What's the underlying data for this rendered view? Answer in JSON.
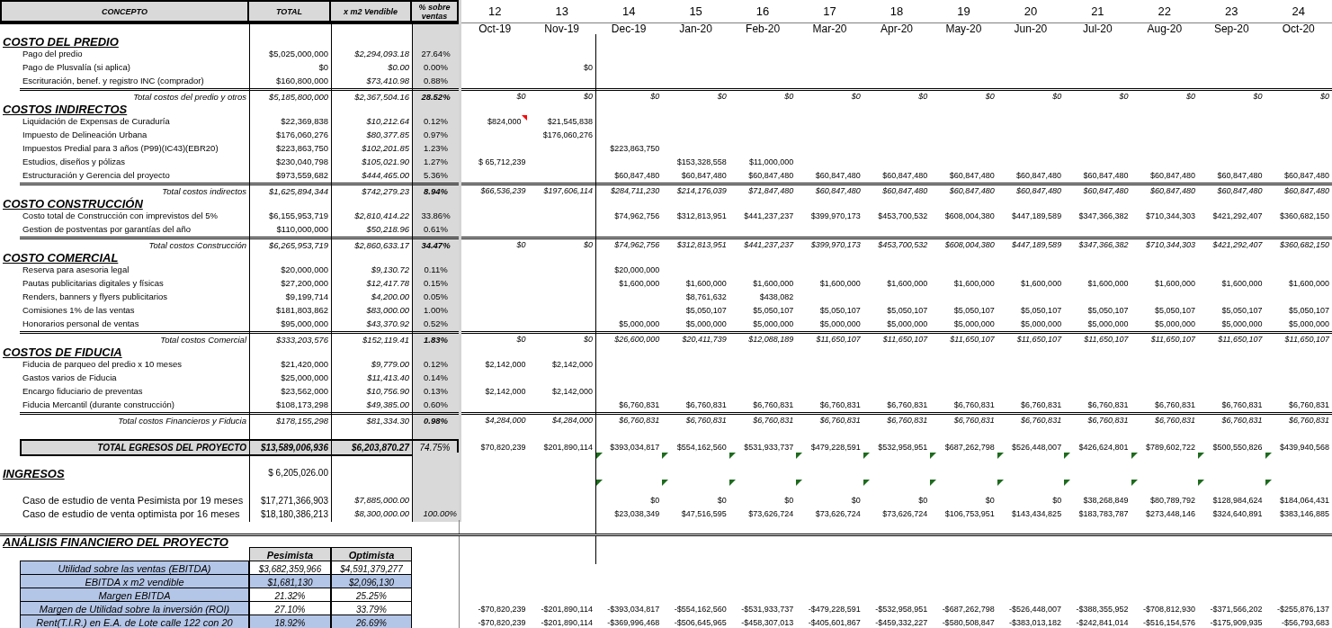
{
  "columns": {
    "concepto": "CONCEPTO",
    "total": "TOTAL",
    "per_m2": "x m2 Vendible",
    "pct": "% sobre ventas"
  },
  "periods": [
    {
      "number": "12",
      "month": "Oct-19"
    },
    {
      "number": "13",
      "month": "Nov-19"
    },
    {
      "number": "14",
      "month": "Dec-19"
    },
    {
      "number": "15",
      "month": "Jan-20"
    },
    {
      "number": "16",
      "month": "Feb-20"
    },
    {
      "number": "17",
      "month": "Mar-20"
    },
    {
      "number": "18",
      "month": "Apr-20"
    },
    {
      "number": "19",
      "month": "May-20"
    },
    {
      "number": "20",
      "month": "Jun-20"
    },
    {
      "number": "21",
      "month": "Jul-20"
    },
    {
      "number": "22",
      "month": "Aug-20"
    },
    {
      "number": "23",
      "month": "Sep-20"
    },
    {
      "number": "24",
      "month": "Oct-20"
    }
  ],
  "rows": [
    {
      "kind": "section",
      "label": "COSTO DEL PREDIO"
    },
    {
      "kind": "item",
      "label": "Pago del predio",
      "total": "$5,025,000,000",
      "per_m2": "$2,294,093.18",
      "pct": "27.64%"
    },
    {
      "kind": "item",
      "label": "Pago de Plusvalía (si aplica)",
      "total": "$0",
      "per_m2": "$0.00",
      "pct": "0.00%",
      "months": {
        "m1": "$0"
      }
    },
    {
      "kind": "item",
      "label": "Escrituración, benef. y registro INC (comprador)",
      "total": "$160,800,000",
      "per_m2": "$73,410.98",
      "pct": "0.88%"
    },
    {
      "kind": "total",
      "label": "Total costos del predio y otros",
      "total": "$5,185,800,000",
      "per_m2": "$2,367,504.16",
      "pct": "28.52%",
      "months": [
        "$0",
        "$0",
        "$0",
        "$0",
        "$0",
        "$0",
        "$0",
        "$0",
        "$0",
        "$0",
        "$0",
        "$0",
        "$0"
      ]
    },
    {
      "kind": "section",
      "label": "COSTOS INDIRECTOS"
    },
    {
      "kind": "item",
      "label": "Liquidación de Expensas de Curaduría",
      "total": "$22,369,838",
      "per_m2": "$10,212.64",
      "pct": "0.12%",
      "months": {
        "m0": {
          "text": "$824,000",
          "comment": true
        },
        "m1": "$21,545,838"
      }
    },
    {
      "kind": "item",
      "label": "Impuesto de Delineación Urbana",
      "total": "$176,060,276",
      "per_m2": "$80,377.85",
      "pct": "0.97%",
      "months": {
        "m1": "$176,060,276"
      }
    },
    {
      "kind": "item",
      "label": "Impuestos Predial para 3 años (P99)(IC43)(EBR20)",
      "total": "$223,863,750",
      "per_m2": "$102,201.85",
      "pct": "1.23%",
      "months": {
        "m2": "$223,863,750"
      }
    },
    {
      "kind": "item",
      "label": "Estudios, diseños y pólizas",
      "total": "$230,040,798",
      "per_m2": "$105,021.90",
      "pct": "1.27%",
      "months": {
        "m0": "$ 65,712,239",
        "m3": "$153,328,558",
        "m4": "$11,000,000"
      }
    },
    {
      "kind": "item",
      "label": "Estructuración y Gerencia del proyecto",
      "total": "$973,559,682",
      "per_m2": "$444,465.00",
      "pct": "5.36%",
      "months": {
        "m2": "$60,847,480",
        "m3": "$60,847,480",
        "m4": "$60,847,480",
        "m5": "$60,847,480",
        "m6": "$60,847,480",
        "m7": "$60,847,480",
        "m8": "$60,847,480",
        "m9": "$60,847,480",
        "m10": "$60,847,480",
        "m11": "$60,847,480",
        "m12": "$60,847,480"
      }
    },
    {
      "kind": "total",
      "label": "Total costos indirectos",
      "total": "$1,625,894,344",
      "per_m2": "$742,279.23",
      "pct": "8.94%",
      "months": [
        "$66,536,239",
        "$197,606,114",
        "$284,711,230",
        "$214,176,039",
        "$71,847,480",
        "$60,847,480",
        "$60,847,480",
        "$60,847,480",
        "$60,847,480",
        "$60,847,480",
        "$60,847,480",
        "$60,847,480",
        "$60,847,480"
      ]
    },
    {
      "kind": "section",
      "label": "COSTO CONSTRUCCIÓN"
    },
    {
      "kind": "item",
      "label": "Costo total de Construcción con imprevistos del 5%",
      "total": "$6,155,953,719",
      "per_m2": "$2,810,414.22",
      "pct": "33.86%",
      "months": {
        "m2": "$74,962,756",
        "m3": "$312,813,951",
        "m4": "$441,237,237",
        "m5": "$399,970,173",
        "m6": "$453,700,532",
        "m7": "$608,004,380",
        "m8": "$447,189,589",
        "m9": "$347,366,382",
        "m10": "$710,344,303",
        "m11": "$421,292,407",
        "m12": "$360,682,150"
      }
    },
    {
      "kind": "item",
      "label": "Gestion de postventas por garantías del año",
      "total": "$110,000,000",
      "per_m2": "$50,218.96",
      "pct": "0.61%"
    },
    {
      "kind": "total",
      "label": "Total costos Construcción",
      "total": "$6,265,953,719",
      "per_m2": "$2,860,633.17",
      "pct": "34.47%",
      "months": [
        "$0",
        "$0",
        "$74,962,756",
        "$312,813,951",
        "$441,237,237",
        "$399,970,173",
        "$453,700,532",
        "$608,004,380",
        "$447,189,589",
        "$347,366,382",
        "$710,344,303",
        "$421,292,407",
        "$360,682,150"
      ]
    },
    {
      "kind": "section",
      "label": "COSTO COMERCIAL"
    },
    {
      "kind": "item",
      "label": "Reserva para asesoria legal",
      "total": "$20,000,000",
      "per_m2": "$9,130.72",
      "pct": "0.11%",
      "months": {
        "m2": "$20,000,000"
      }
    },
    {
      "kind": "item",
      "label": "Pautas publicitarias digitales y físicas",
      "total": "$27,200,000",
      "per_m2": "$12,417.78",
      "pct": "0.15%",
      "months": {
        "m2": "$1,600,000",
        "m3": "$1,600,000",
        "m4": "$1,600,000",
        "m5": "$1,600,000",
        "m6": "$1,600,000",
        "m7": "$1,600,000",
        "m8": "$1,600,000",
        "m9": "$1,600,000",
        "m10": "$1,600,000",
        "m11": "$1,600,000",
        "m12": "$1,600,000"
      }
    },
    {
      "kind": "item",
      "label": "Renders, banners y flyers publicitarios",
      "total": "$9,199,714",
      "per_m2": "$4,200.00",
      "pct": "0.05%",
      "months": {
        "m3": "$8,761,632",
        "m4": "$438,082"
      }
    },
    {
      "kind": "item",
      "label": "Comisiones 1% de las ventas",
      "total": "$181,803,862",
      "per_m2": "$83,000.00",
      "pct": "1.00%",
      "months": {
        "m3": "$5,050,107",
        "m4": "$5,050,107",
        "m5": "$5,050,107",
        "m6": "$5,050,107",
        "m7": "$5,050,107",
        "m8": "$5,050,107",
        "m9": "$5,050,107",
        "m10": "$5,050,107",
        "m11": "$5,050,107",
        "m12": "$5,050,107"
      }
    },
    {
      "kind": "item",
      "label": "Honorarios personal de ventas",
      "total": "$95,000,000",
      "per_m2": "$43,370.92",
      "pct": "0.52%",
      "months": {
        "m2": "$5,000,000",
        "m3": "$5,000,000",
        "m4": "$5,000,000",
        "m5": "$5,000,000",
        "m6": "$5,000,000",
        "m7": "$5,000,000",
        "m8": "$5,000,000",
        "m9": "$5,000,000",
        "m10": "$5,000,000",
        "m11": "$5,000,000",
        "m12": "$5,000,000"
      }
    },
    {
      "kind": "total",
      "label": "Total costos Comercial",
      "total": "$333,203,576",
      "per_m2": "$152,119.41",
      "pct": "1.83%",
      "months": [
        "$0",
        "$0",
        "$26,600,000",
        "$20,411,739",
        "$12,088,189",
        "$11,650,107",
        "$11,650,107",
        "$11,650,107",
        "$11,650,107",
        "$11,650,107",
        "$11,650,107",
        "$11,650,107",
        "$11,650,107"
      ]
    },
    {
      "kind": "section",
      "label": "COSTOS DE FIDUCIA"
    },
    {
      "kind": "item",
      "label": "Fiducia de parqueo del predio x 10 meses",
      "total": "$21,420,000",
      "per_m2": "$9,779.00",
      "pct": "0.12%",
      "months": {
        "m0": "$2,142,000",
        "m1": "$2,142,000"
      }
    },
    {
      "kind": "item",
      "label": "Gastos varios de Fiducia",
      "total": "$25,000,000",
      "per_m2": "$11,413.40",
      "pct": "0.14%"
    },
    {
      "kind": "item",
      "label": "Encargo fiduciario de preventas",
      "total": "$23,562,000",
      "per_m2": "$10,756.90",
      "pct": "0.13%",
      "months": {
        "m0": "$2,142,000",
        "m1": "$2,142,000"
      }
    },
    {
      "kind": "item",
      "label": "Fiducia Mercantil (durante construcción)",
      "total": "$108,173,298",
      "per_m2": "$49,385.00",
      "pct": "0.60%",
      "months": {
        "m2": "$6,760,831",
        "m3": "$6,760,831",
        "m4": "$6,760,831",
        "m5": "$6,760,831",
        "m6": "$6,760,831",
        "m7": "$6,760,831",
        "m8": "$6,760,831",
        "m9": "$6,760,831",
        "m10": "$6,760,831",
        "m11": "$6,760,831",
        "m12": "$6,760,831"
      }
    },
    {
      "kind": "total",
      "label": "Total costos Financieros y Fiducia",
      "total": "$178,155,298",
      "per_m2": "$81,334.30",
      "pct": "0.98%",
      "months": [
        "$4,284,000",
        "$4,284,000",
        "$6,760,831",
        "$6,760,831",
        "$6,760,831",
        "$6,760,831",
        "$6,760,831",
        "$6,760,831",
        "$6,760,831",
        "$6,760,831",
        "$6,760,831",
        "$6,760,831",
        "$6,760,831"
      ]
    },
    {
      "kind": "blank"
    },
    {
      "kind": "grand",
      "label": "TOTAL EGRESOS DEL PROYECTO",
      "total": "$13,589,006,936",
      "per_m2": "$6,203,870.27",
      "pct": "74.75%",
      "months": [
        "$70,820,239",
        "$201,890,114",
        "$393,034,817",
        "$554,162,560",
        "$531,933,737",
        "$479,228,591",
        "$532,958,951",
        "$687,262,798",
        "$526,448,007",
        "$426,624,801",
        "$789,602,722",
        "$500,550,826",
        "$439,940,568"
      ]
    },
    {
      "kind": "indicators",
      "flags": [
        false,
        false,
        true,
        true,
        true,
        true,
        true,
        true,
        true,
        true,
        true,
        true,
        true
      ]
    },
    {
      "kind": "section",
      "label": "INGRESOS",
      "total": "$ 6,205,026.00"
    },
    {
      "kind": "indicators",
      "flags": [
        false,
        false,
        true,
        true,
        true,
        true,
        true,
        true,
        true,
        true,
        true,
        true,
        true
      ]
    },
    {
      "kind": "case",
      "label": "Caso de estudio de venta Pesimista por 19 meses",
      "total": "$17,271,366,903",
      "per_m2": "$7,885,000.00",
      "months": {
        "m2": "$0",
        "m3": "$0",
        "m4": "$0",
        "m5": "$0",
        "m6": "$0",
        "m7": "$0",
        "m8": "$0",
        "m9": "$38,268,849",
        "m10": "$80,789,792",
        "m11": "$128,984,624",
        "m12": "$184,064,431"
      }
    },
    {
      "kind": "case",
      "label": "Caso de estudio de venta optimista por 16 meses",
      "total": "$18,180,386,213",
      "per_m2": "$8,300,000.00",
      "pct": "100.00%",
      "months": {
        "m2": "$23,038,349",
        "m3": "$47,516,595",
        "m4": "$73,626,724",
        "m5": "$73,626,724",
        "m6": "$73,626,724",
        "m7": "$106,753,951",
        "m8": "$143,434,825",
        "m9": "$183,783,787",
        "m10": "$273,448,146",
        "m11": "$324,640,891",
        "m12": "$383,146,885"
      }
    },
    {
      "kind": "blank_wide"
    },
    {
      "kind": "analysis_title",
      "label": "ANÁLISIS FINANCIERO DEL PROYECTO"
    },
    {
      "kind": "analysis_header",
      "values": [
        "Pesimista",
        "Optimista"
      ]
    },
    {
      "kind": "analysis",
      "label": "Utilidad sobre las ventas (EBITDA)",
      "values": [
        {
          "text": "$3,682,359,966",
          "shaded": false
        },
        {
          "text": "$4,591,379,277",
          "shaded": false
        }
      ]
    },
    {
      "kind": "analysis",
      "label": "EBITDA x m2 vendible",
      "values": [
        {
          "text": "$1,681,130",
          "shaded": true
        },
        {
          "text": "$2,096,130",
          "shaded": true
        }
      ]
    },
    {
      "kind": "analysis",
      "label": "Margen EBITDA",
      "values": [
        {
          "text": "21.32%",
          "shaded": false
        },
        {
          "text": "25.25%",
          "shaded": false
        }
      ]
    },
    {
      "kind": "analysis",
      "label": "Margen de Utilidad sobre la inversión (ROI)",
      "values": [
        {
          "text": "27.10%",
          "shaded": false
        },
        {
          "text": "33.79%",
          "shaded": false
        }
      ],
      "months": [
        "-$70,820,239",
        "-$201,890,114",
        "-$393,034,817",
        "-$554,162,560",
        "-$531,933,737",
        "-$479,228,591",
        "-$532,958,951",
        "-$687,262,798",
        "-$526,448,007",
        "-$388,355,952",
        "-$708,812,930",
        "-$371,566,202",
        "-$255,876,137"
      ]
    },
    {
      "kind": "analysis",
      "label": "Rent(T.I.R.) en E.A. de Lote calle 122 con  20",
      "values": [
        {
          "text": "18.92%",
          "shaded": true
        },
        {
          "text": "26.69%",
          "shaded": true
        }
      ],
      "months": [
        "-$70,820,239",
        "-$201,890,114",
        "-$369,996,468",
        "-$506,645,965",
        "-$458,307,013",
        "-$405,601,867",
        "-$459,332,227",
        "-$580,508,847",
        "-$383,013,182",
        "-$242,841,014",
        "-$516,154,576",
        "-$175,909,935",
        "-$56,793,683"
      ]
    }
  ]
}
